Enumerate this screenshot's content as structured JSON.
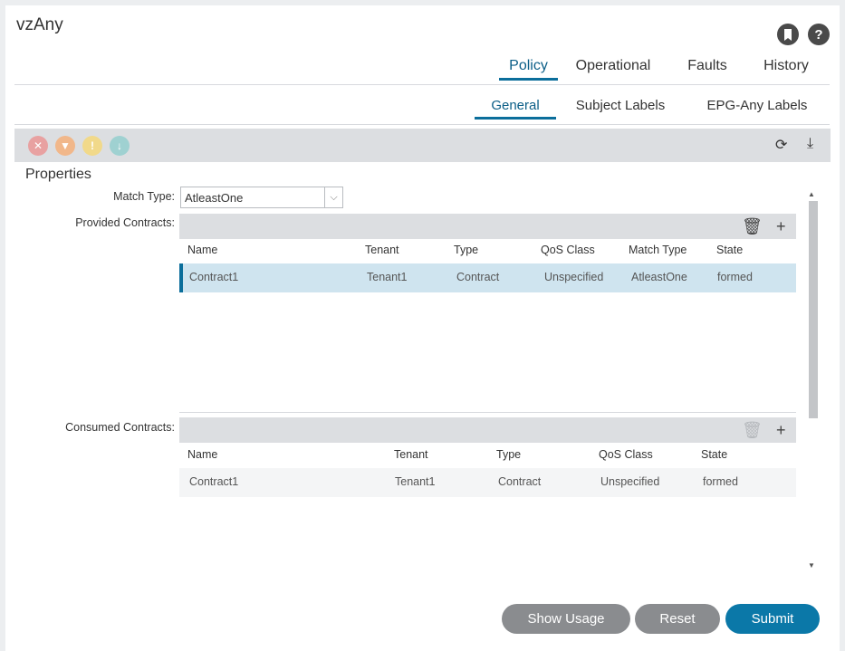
{
  "window": {
    "title": "vzAny"
  },
  "header_icons": {
    "bookmark": "bookmark-icon",
    "help": "?"
  },
  "main_tabs": [
    {
      "label": "Policy",
      "active": true
    },
    {
      "label": "Operational",
      "active": false
    },
    {
      "label": "Faults",
      "active": false
    },
    {
      "label": "History",
      "active": false
    }
  ],
  "sub_tabs": [
    {
      "label": "General",
      "active": true
    },
    {
      "label": "Subject Labels",
      "active": false
    },
    {
      "label": "EPG-Any Labels",
      "active": false
    }
  ],
  "toolbar": {
    "fault_icons": [
      "critical-fault-icon",
      "major-fault-icon",
      "minor-fault-icon",
      "warning-fault-icon"
    ],
    "colors": {
      "critical": "#e8a1a1",
      "major": "#f1b78a",
      "minor": "#f1d98a",
      "warning": "#9fd1d1"
    }
  },
  "properties": {
    "section_title": "Properties",
    "match_type": {
      "label": "Match Type:",
      "value": "AtleastOne"
    },
    "provided": {
      "label": "Provided Contracts:",
      "headers": [
        "Name",
        "Tenant",
        "Type",
        "QoS Class",
        "Match Type",
        "State"
      ],
      "rows": [
        [
          "Contract1",
          "Tenant1",
          "Contract",
          "Unspecified",
          "AtleastOne",
          "formed"
        ]
      ]
    },
    "consumed": {
      "label": "Consumed Contracts:",
      "headers": [
        "Name",
        "Tenant",
        "Type",
        "QoS Class",
        "State"
      ],
      "rows": [
        [
          "Contract1",
          "Tenant1",
          "Contract",
          "Unspecified",
          "formed"
        ]
      ]
    }
  },
  "buttons": {
    "show_usage": "Show Usage",
    "reset": "Reset",
    "submit": "Submit"
  },
  "accent_color": "#0b6e9b"
}
